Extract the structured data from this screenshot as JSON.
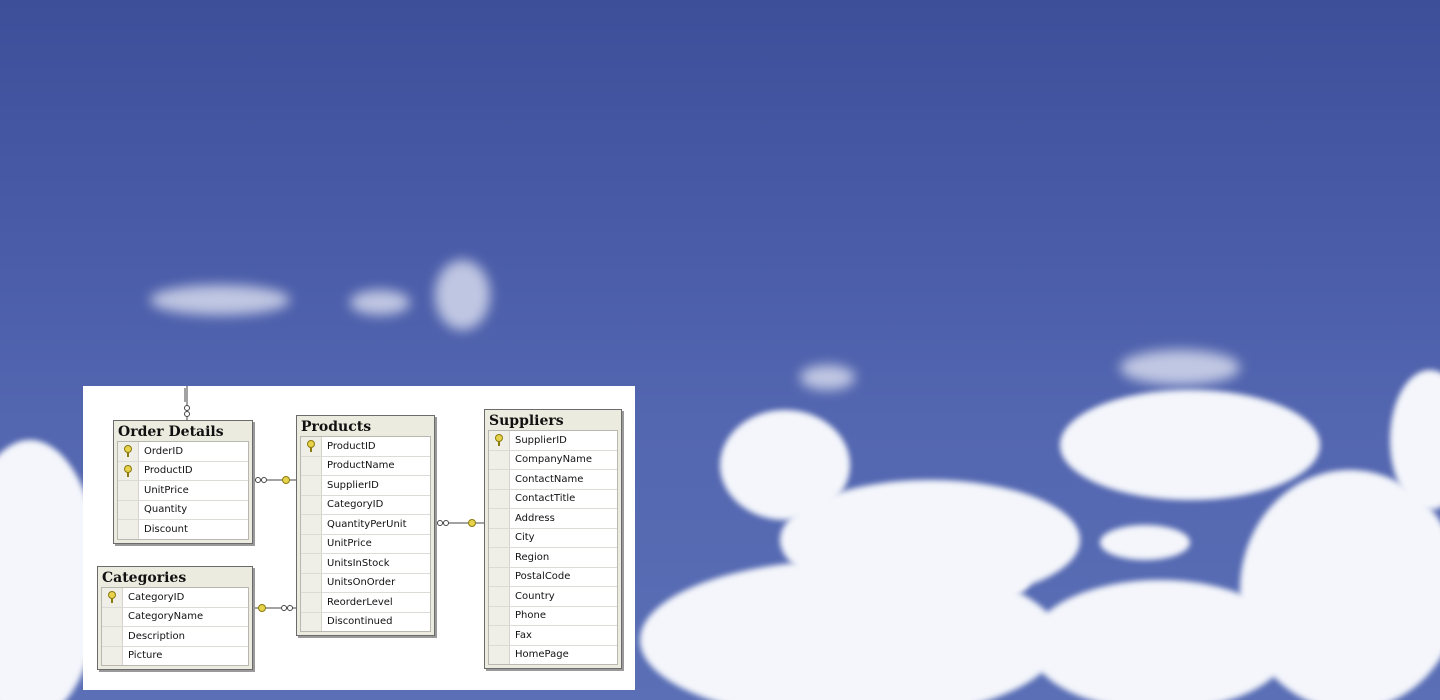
{
  "diagram": {
    "tables": {
      "order_details": {
        "title": "Order Details",
        "columns": [
          {
            "name": "OrderID",
            "pk": true
          },
          {
            "name": "ProductID",
            "pk": true
          },
          {
            "name": "UnitPrice",
            "pk": false
          },
          {
            "name": "Quantity",
            "pk": false
          },
          {
            "name": "Discount",
            "pk": false
          }
        ]
      },
      "categories": {
        "title": "Categories",
        "columns": [
          {
            "name": "CategoryID",
            "pk": true
          },
          {
            "name": "CategoryName",
            "pk": false
          },
          {
            "name": "Description",
            "pk": false
          },
          {
            "name": "Picture",
            "pk": false
          }
        ]
      },
      "products": {
        "title": "Products",
        "columns": [
          {
            "name": "ProductID",
            "pk": true
          },
          {
            "name": "ProductName",
            "pk": false
          },
          {
            "name": "SupplierID",
            "pk": false
          },
          {
            "name": "CategoryID",
            "pk": false
          },
          {
            "name": "QuantityPerUnit",
            "pk": false
          },
          {
            "name": "UnitPrice",
            "pk": false
          },
          {
            "name": "UnitsInStock",
            "pk": false
          },
          {
            "name": "UnitsOnOrder",
            "pk": false
          },
          {
            "name": "ReorderLevel",
            "pk": false
          },
          {
            "name": "Discontinued",
            "pk": false
          }
        ]
      },
      "suppliers": {
        "title": "Suppliers",
        "columns": [
          {
            "name": "SupplierID",
            "pk": true
          },
          {
            "name": "CompanyName",
            "pk": false
          },
          {
            "name": "ContactName",
            "pk": false
          },
          {
            "name": "ContactTitle",
            "pk": false
          },
          {
            "name": "Address",
            "pk": false
          },
          {
            "name": "City",
            "pk": false
          },
          {
            "name": "Region",
            "pk": false
          },
          {
            "name": "PostalCode",
            "pk": false
          },
          {
            "name": "Country",
            "pk": false
          },
          {
            "name": "Phone",
            "pk": false
          },
          {
            "name": "Fax",
            "pk": false
          },
          {
            "name": "HomePage",
            "pk": false
          }
        ]
      }
    },
    "colors": {
      "header": "#ecebdf",
      "key": "#e7d34a",
      "line": "#444444"
    }
  }
}
